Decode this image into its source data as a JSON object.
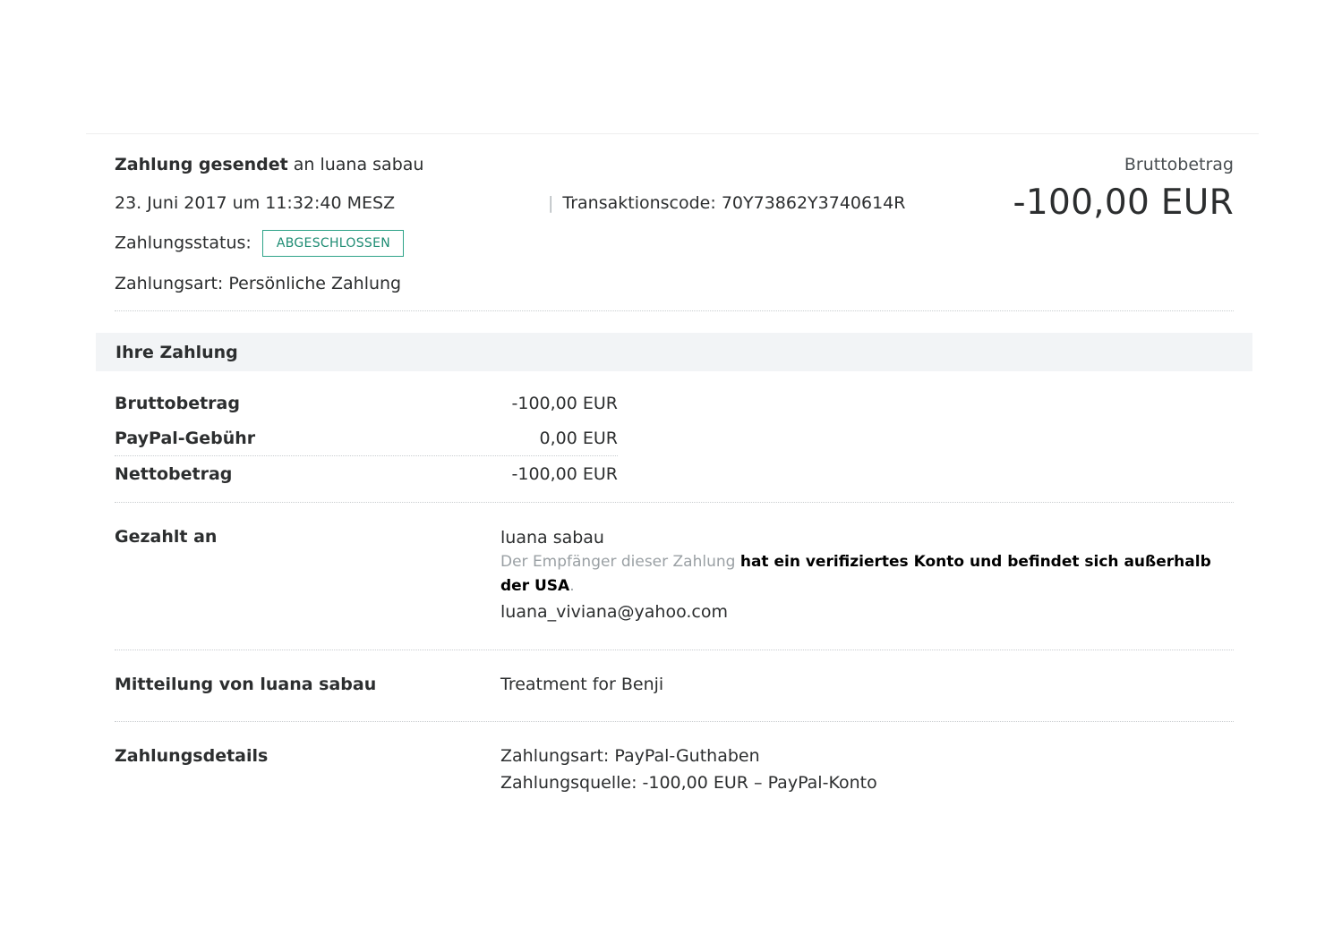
{
  "header": {
    "title_strong": "Zahlung gesendet",
    "title_rest": "an luana sabau",
    "date": "23. Juni 2017 um 11:32:40 MESZ",
    "separator": "|",
    "transaction_label": "Transaktionscode: 70Y73862Y3740614R",
    "status_label": "Zahlungsstatus:",
    "status_badge": "ABGESCHLOSSEN",
    "payment_type": "Zahlungsart: Persönliche Zahlung",
    "gross_label": "Bruttobetrag",
    "gross_amount": "-100,00 EUR"
  },
  "payment_section": {
    "title": "Ihre Zahlung",
    "rows": [
      {
        "label": "Bruttobetrag",
        "value": "-100,00 EUR"
      },
      {
        "label": "PayPal-Gebühr",
        "value": "0,00 EUR"
      },
      {
        "label": "Nettobetrag",
        "value": "-100,00 EUR"
      }
    ]
  },
  "paid_to": {
    "label": "Gezahlt an",
    "name": "luana sabau",
    "note_grey": "Der Empfänger dieser Zahlung",
    "note_bold": "hat ein verifiziertes Konto und befindet sich außerhalb der USA",
    "note_end": ".",
    "email": "luana_viviana@yahoo.com"
  },
  "message": {
    "label": "Mitteilung von luana sabau",
    "text": "Treatment for Benji"
  },
  "details": {
    "label": "Zahlungsdetails",
    "line1": "Zahlungsart: PayPal-Guthaben",
    "line2": "Zahlungsquelle: -100,00 EUR – PayPal-Konto"
  },
  "colors": {
    "status_green": "#2ea389",
    "band_bg": "#f2f4f6",
    "text": "#2c2e2f"
  }
}
